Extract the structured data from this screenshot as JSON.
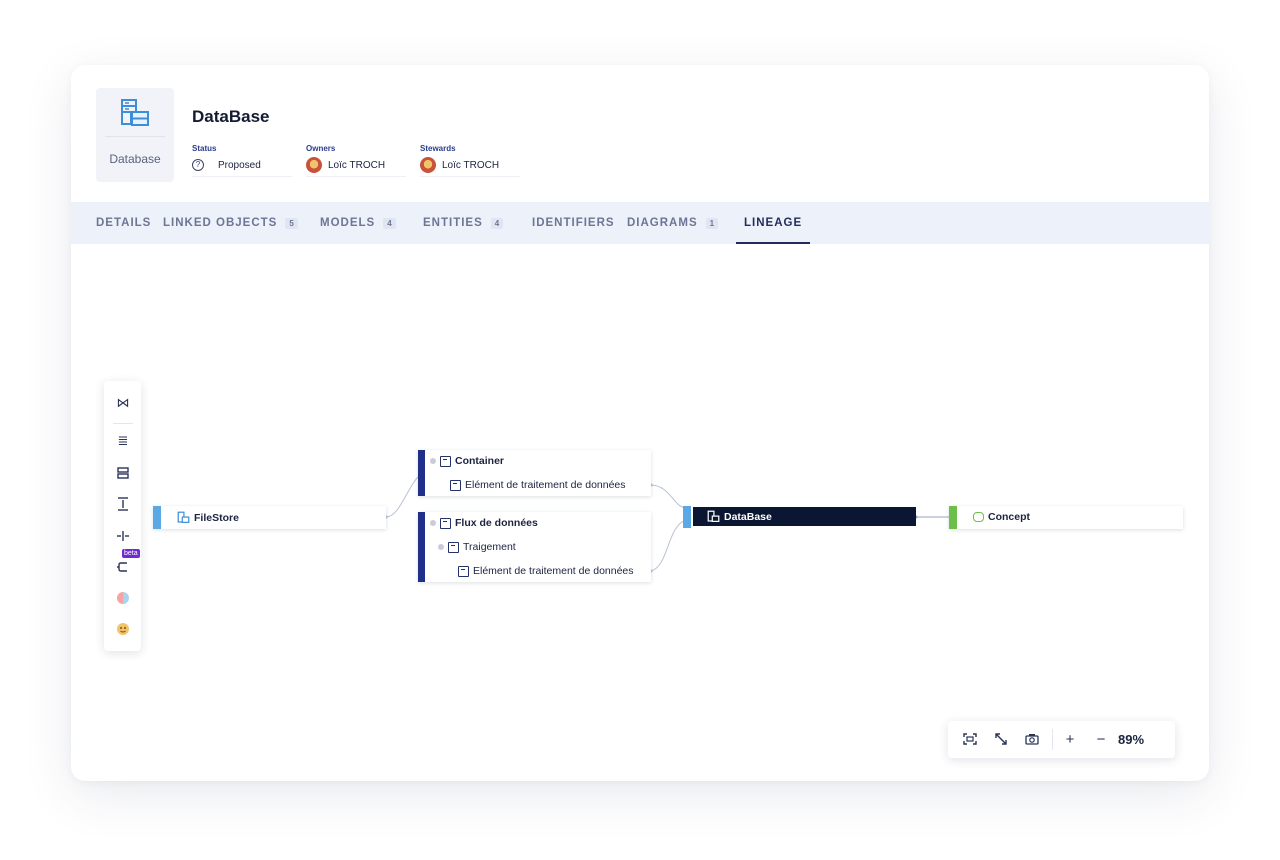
{
  "object": {
    "type_label": "Database",
    "type_icon": "database-icon",
    "title": "DataBase",
    "status": {
      "label": "Status",
      "value": "Proposed"
    },
    "owners": {
      "label": "Owners",
      "value": "Loïc TROCH"
    },
    "stewards": {
      "label": "Stewards",
      "value": "Loïc TROCH"
    }
  },
  "tabs": [
    {
      "label": "DETAILS",
      "count": ""
    },
    {
      "label": "LINKED OBJECTS",
      "count": "5"
    },
    {
      "label": "MODELS",
      "count": "4"
    },
    {
      "label": "ENTITIES",
      "count": "4"
    },
    {
      "label": "IDENTIFIERS",
      "count": ""
    },
    {
      "label": "DIAGRAMS",
      "count": "1"
    },
    {
      "label": "LINEAGE",
      "count": "",
      "active": true
    }
  ],
  "toolbar": {
    "icons": [
      "collapse-expand-icon",
      "list-layout-icon",
      "compact-layout-icon",
      "vertical-spacing-icon",
      "horizontal-spacing-icon",
      "lineage-beta-icon",
      "color-toggle-icon",
      "avatar-toggle-icon"
    ],
    "beta_label": "beta"
  },
  "lineage": {
    "filestore": {
      "label": "FileStore",
      "accent": "#5aa9e6"
    },
    "container": {
      "label": "Container",
      "child": "Elément de traitement de données",
      "accent": "#1f2f8a"
    },
    "flux": {
      "label": "Flux de données",
      "child": "Traigement",
      "grandchild": "Elément de traitement de données",
      "accent": "#1f2f8a"
    },
    "database": {
      "label": "DataBase",
      "accent": "#5aa9e6",
      "fill": "#0b1633"
    },
    "concept": {
      "label": "Concept",
      "accent": "#6cc04a"
    }
  },
  "zoom": {
    "value": "89%",
    "icons": [
      "fit-screen-icon",
      "expand-diagonal-icon",
      "camera-icon",
      "zoom-in-icon",
      "zoom-out-icon"
    ]
  }
}
